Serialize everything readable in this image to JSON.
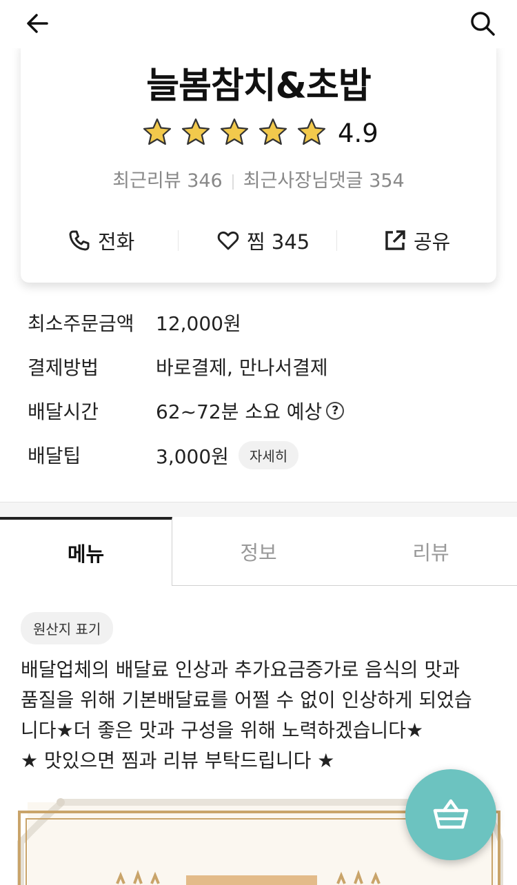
{
  "header": {
    "back_icon": "arrow-left-icon",
    "search_icon": "search-icon"
  },
  "store": {
    "name": "늘봄참치&초밥",
    "rating": "4.9",
    "star_count": 5,
    "recent_reviews": "최근리뷰 346",
    "owner_replies": "최근사장님댓글 354"
  },
  "actions": {
    "call_label": "전화",
    "favorite_label": "찜 345",
    "share_label": "공유"
  },
  "info": {
    "min_order_label": "최소주문금액",
    "min_order_value": "12,000원",
    "payment_label": "결제방법",
    "payment_value": "바로결제, 만나서결제",
    "delivery_time_label": "배달시간",
    "delivery_time_value": "62~72분 소요 예상",
    "help_glyph": "?",
    "delivery_tip_label": "배달팁",
    "delivery_tip_value": "3,000원",
    "detail_button": "자세히"
  },
  "tabs": [
    {
      "label": "메뉴",
      "active": true
    },
    {
      "label": "정보",
      "active": false
    },
    {
      "label": "리뷰",
      "active": false
    }
  ],
  "menu": {
    "origin_label": "원산지 표기",
    "notice_lines": [
      "배달업체의 배달료 인상과 추가요금증가로 음식의 맛과",
      "품질을 위해 기본배달료를 어쩔 수 없이 인상하게 되었습",
      "니다★더 좋은 맛과 구성을 위해 노력하겠습니다★",
      "★ 맛있으면 찜과 리뷰 부탁드립니다 ★"
    ]
  },
  "colors": {
    "fab": "#6cc3c0",
    "star": "#f2c94c",
    "banner_gold": "#c9a46a"
  },
  "fab_icon": "basket-icon"
}
